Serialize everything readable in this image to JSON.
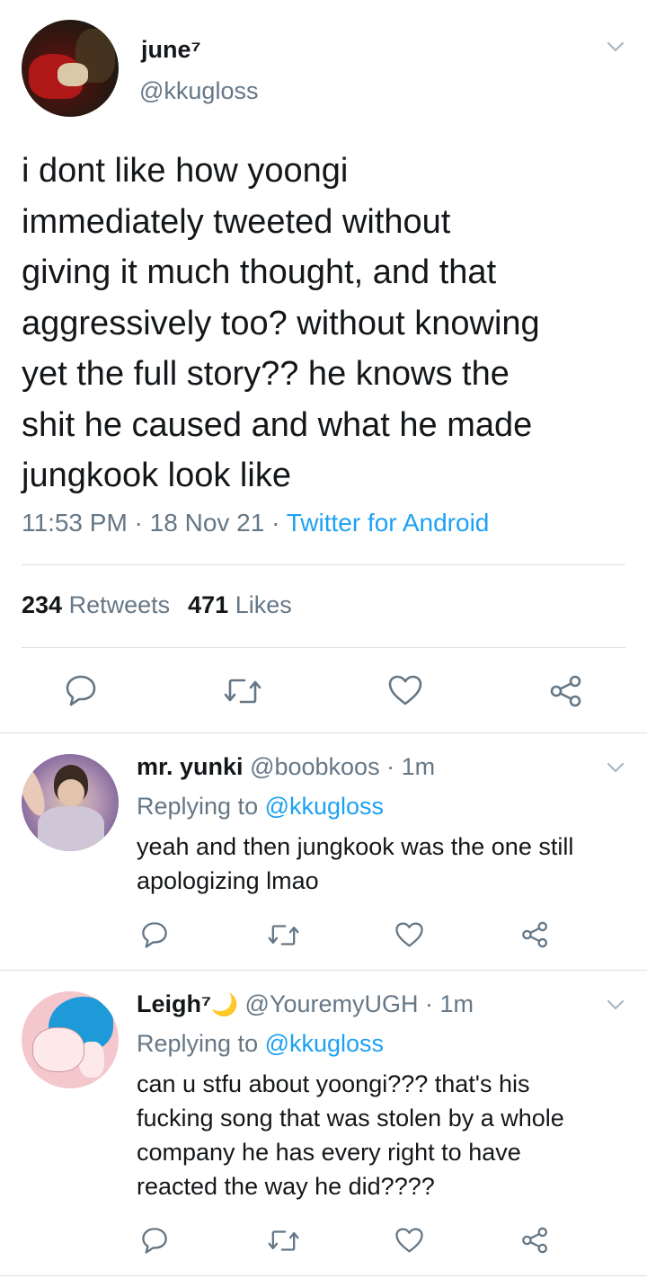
{
  "main_tweet": {
    "name": "june⁷",
    "handle": "@kkugloss",
    "text": "i dont like how yoongi\nimmediately tweeted without\ngiving it much thought, and that\naggressively too? without knowing\nyet the full story?? he knows the\nshit he caused and what he made\njungkook look like",
    "time": "11:53 PM",
    "date": "18 Nov 21",
    "separator": " · ",
    "source": "Twitter for Android",
    "retweets_count": "234",
    "retweets_label": "Retweets",
    "likes_count": "471",
    "likes_label": "Likes"
  },
  "replies": [
    {
      "name": "mr. yunki",
      "handle": "@boobkoos",
      "time": "1m",
      "separator": " · ",
      "replying_prefix": "Replying to ",
      "replying_to": "@kkugloss",
      "text": "yeah and then jungkook was the one still\napologizing lmao"
    },
    {
      "name": "Leigh⁷",
      "emoji": "🌙",
      "handle": "@YouremyUGH",
      "time": "1m",
      "separator": " · ",
      "replying_prefix": "Replying to ",
      "replying_to": "@kkugloss",
      "text": "can u stfu about yoongi??? that's his\nfucking song that was stolen by a whole\ncompany he has every right to have\nreacted the way he did????"
    }
  ],
  "icons": {
    "reply": "reply-icon",
    "retweet": "retweet-icon",
    "like": "heart-icon",
    "share": "share-icon",
    "menu": "chevron-down-icon"
  },
  "colors": {
    "text": "#14171a",
    "secondary": "#657786",
    "link": "#1da1f2",
    "divider": "#d8dee3"
  }
}
